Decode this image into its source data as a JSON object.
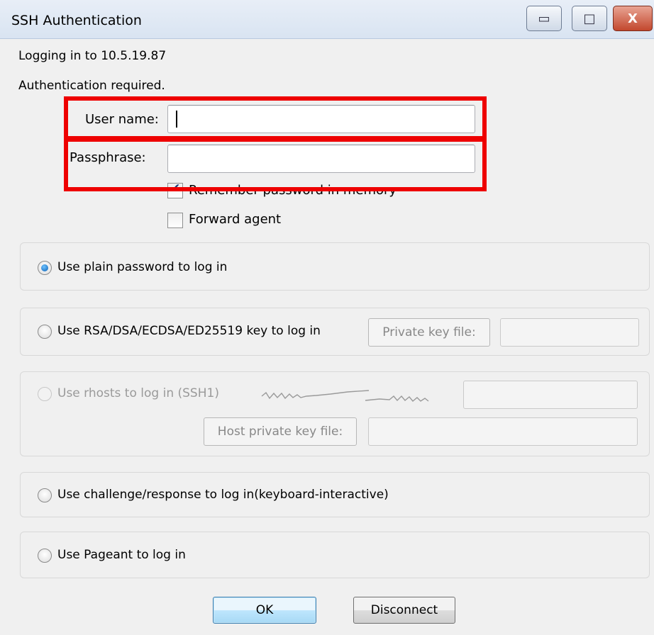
{
  "window": {
    "title": "SSH Authentication",
    "controls": {
      "minimize": "▭",
      "maximize": "□",
      "close": "X"
    }
  },
  "status": {
    "logging_in": "Logging in to 10.5.19.87",
    "auth_required": "Authentication required."
  },
  "form": {
    "user_name_label": "User name:",
    "user_name_value": "",
    "passphrase_label": "Passphrase:",
    "passphrase_value": "",
    "remember_label": "Remember password in memory",
    "remember_checked": true,
    "forward_agent_label": "Forward agent",
    "forward_agent_checked": false
  },
  "methods": {
    "plain": {
      "label": "Use plain password to log in",
      "selected": true
    },
    "rsa": {
      "label": "Use RSA/DSA/ECDSA/ED25519 key to log in",
      "private_key_button": "Private key file:"
    },
    "rhosts": {
      "label": "Use rhosts to log in (SSH1)",
      "host_key_button": "Host private key file:"
    },
    "challenge": {
      "label": "Use challenge/response to log in(keyboard-interactive)"
    },
    "pageant": {
      "label": "Use Pageant to log in"
    }
  },
  "buttons": {
    "ok": "OK",
    "disconnect": "Disconnect"
  },
  "colors": {
    "highlight": "#ee0000",
    "default_button": "#bee6fd"
  }
}
